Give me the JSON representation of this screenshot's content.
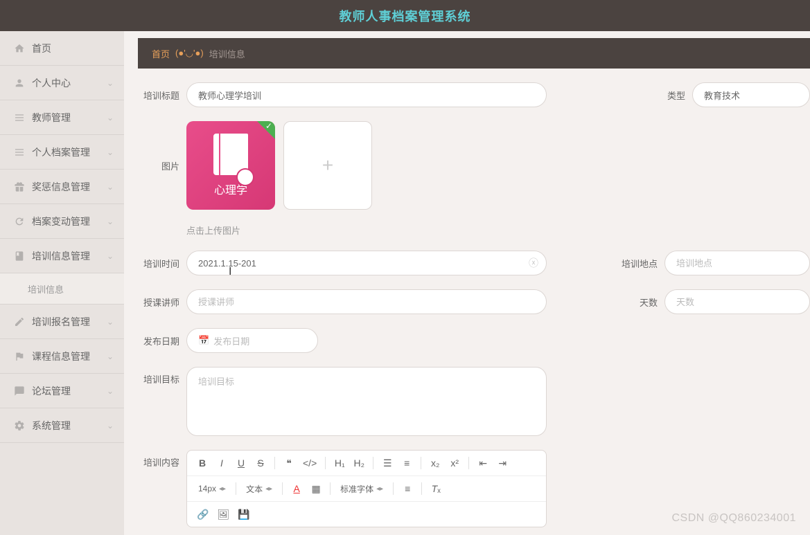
{
  "header": {
    "title": "教师人事档案管理系统"
  },
  "sidebar": {
    "items": [
      {
        "label": "首页",
        "icon": "home"
      },
      {
        "label": "个人中心",
        "icon": "user"
      },
      {
        "label": "教师管理",
        "icon": "list"
      },
      {
        "label": "个人档案管理",
        "icon": "list"
      },
      {
        "label": "奖惩信息管理",
        "icon": "gift"
      },
      {
        "label": "档案变动管理",
        "icon": "refresh"
      },
      {
        "label": "培训信息管理",
        "icon": "book"
      },
      {
        "label": "培训信息",
        "sub": true
      },
      {
        "label": "培训报名管理",
        "icon": "edit"
      },
      {
        "label": "课程信息管理",
        "icon": "flag"
      },
      {
        "label": "论坛管理",
        "icon": "chat"
      },
      {
        "label": "系统管理",
        "icon": "gear"
      }
    ]
  },
  "breadcrumb": {
    "home": "首页",
    "emoji": "(●'◡'●)",
    "current": "培训信息"
  },
  "form": {
    "title_label": "培训标题",
    "title_value": "教师心理学培训",
    "type_label": "类型",
    "type_value": "教育技术",
    "image_label": "图片",
    "image_card_text": "心理学",
    "upload_hint": "点击上传图片",
    "time_label": "培训时间",
    "time_value": "2021.1.15-201",
    "location_label": "培训地点",
    "location_placeholder": "培训地点",
    "teacher_label": "授课讲师",
    "teacher_placeholder": "授课讲师",
    "days_label": "天数",
    "days_placeholder": "天数",
    "pubdate_label": "发布日期",
    "pubdate_placeholder": "发布日期",
    "goal_label": "培训目标",
    "goal_placeholder": "培训目标",
    "content_label": "培训内容"
  },
  "editor": {
    "font_size": "14px",
    "text_type": "文本",
    "font_family": "标准字体"
  },
  "watermark": "CSDN @QQ860234001"
}
